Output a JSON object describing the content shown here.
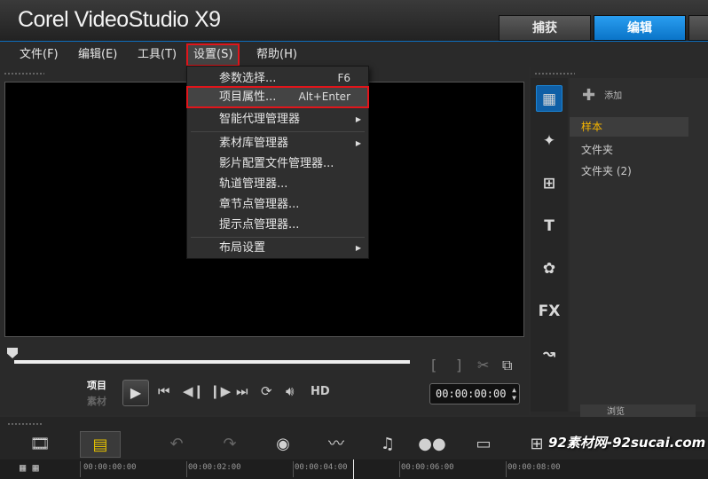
{
  "app": {
    "title": "Corel VideoStudio X9"
  },
  "mode_tabs": {
    "capture": "捕获",
    "edit": "编辑"
  },
  "menubar": [
    {
      "label": "文件(F)"
    },
    {
      "label": "编辑(E)"
    },
    {
      "label": "工具(T)"
    },
    {
      "label": "设置(S)"
    },
    {
      "label": "帮助(H)"
    }
  ],
  "settings_menu": {
    "items": [
      {
        "label": "参数选择...",
        "shortcut": "F6"
      },
      {
        "label": "项目属性...",
        "shortcut": "Alt+Enter"
      },
      {
        "label": "智能代理管理器"
      },
      {
        "label": "素材库管理器"
      },
      {
        "label": "影片配置文件管理器..."
      },
      {
        "label": "轨道管理器..."
      },
      {
        "label": "章节点管理器..."
      },
      {
        "label": "提示点管理器..."
      },
      {
        "label": "布局设置"
      }
    ]
  },
  "player": {
    "mode_project": "项目",
    "mode_clip": "素材",
    "hd": "HD",
    "timecode": "00:00:00:00"
  },
  "library": {
    "add_label": "添加",
    "folders": [
      {
        "label": "样本"
      },
      {
        "label": "文件夹"
      },
      {
        "label": "文件夹 (2)"
      }
    ],
    "browse_label": "浏览"
  },
  "timeline": {
    "ruler": [
      "00:00:00:00",
      "00:00:02:00",
      "00:00:04:00",
      "00:00:06:00",
      "00:00:08:00"
    ]
  },
  "watermark": "92素材网-92sucai.com",
  "colors": {
    "accent": "#0a74c8",
    "highlight_box": "#e0151b",
    "selected_folder": "#f5b500"
  }
}
